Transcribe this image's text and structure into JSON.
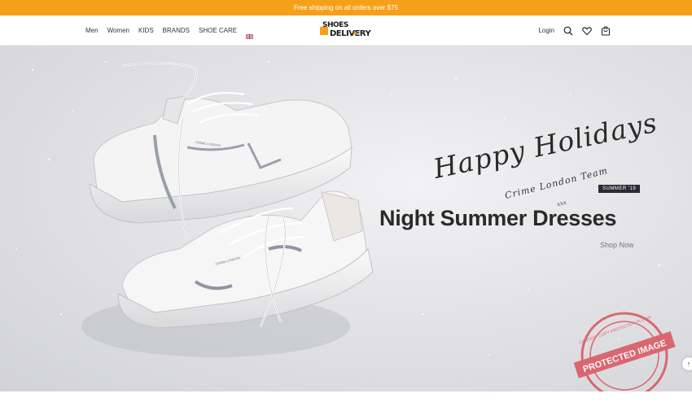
{
  "promo": {
    "text": "Free shipping on all orders over $75"
  },
  "nav": {
    "items": [
      {
        "label": "Men"
      },
      {
        "label": "Women"
      },
      {
        "label": "KIDS"
      },
      {
        "label": "BRANDS"
      },
      {
        "label": "SHOE CARE"
      }
    ],
    "language_flag": "uk-flag-icon"
  },
  "logo": {
    "line1": "SHOES",
    "line2": "DELIVERY"
  },
  "actions": {
    "login_label": "Login",
    "icons": [
      "search-icon",
      "heart-icon",
      "bag-icon"
    ]
  },
  "hero": {
    "script_main": "Happy Holidays",
    "script_sub": "Crime London Team",
    "script_sign": "xxx",
    "badge": "SUMMER '19",
    "title": "Night Summer Dresses",
    "cta": "Shop Now",
    "shoe_brand": "CRIME LONDON"
  },
  "watermark": {
    "text_main": "PROTECTED IMAGE",
    "text_ring": "CONTENT COPY PROTECTION PLUGIN"
  },
  "colors": {
    "accent": "#f6a01a",
    "badge_bg": "#2b2b35",
    "watermark": "#d9404a"
  }
}
